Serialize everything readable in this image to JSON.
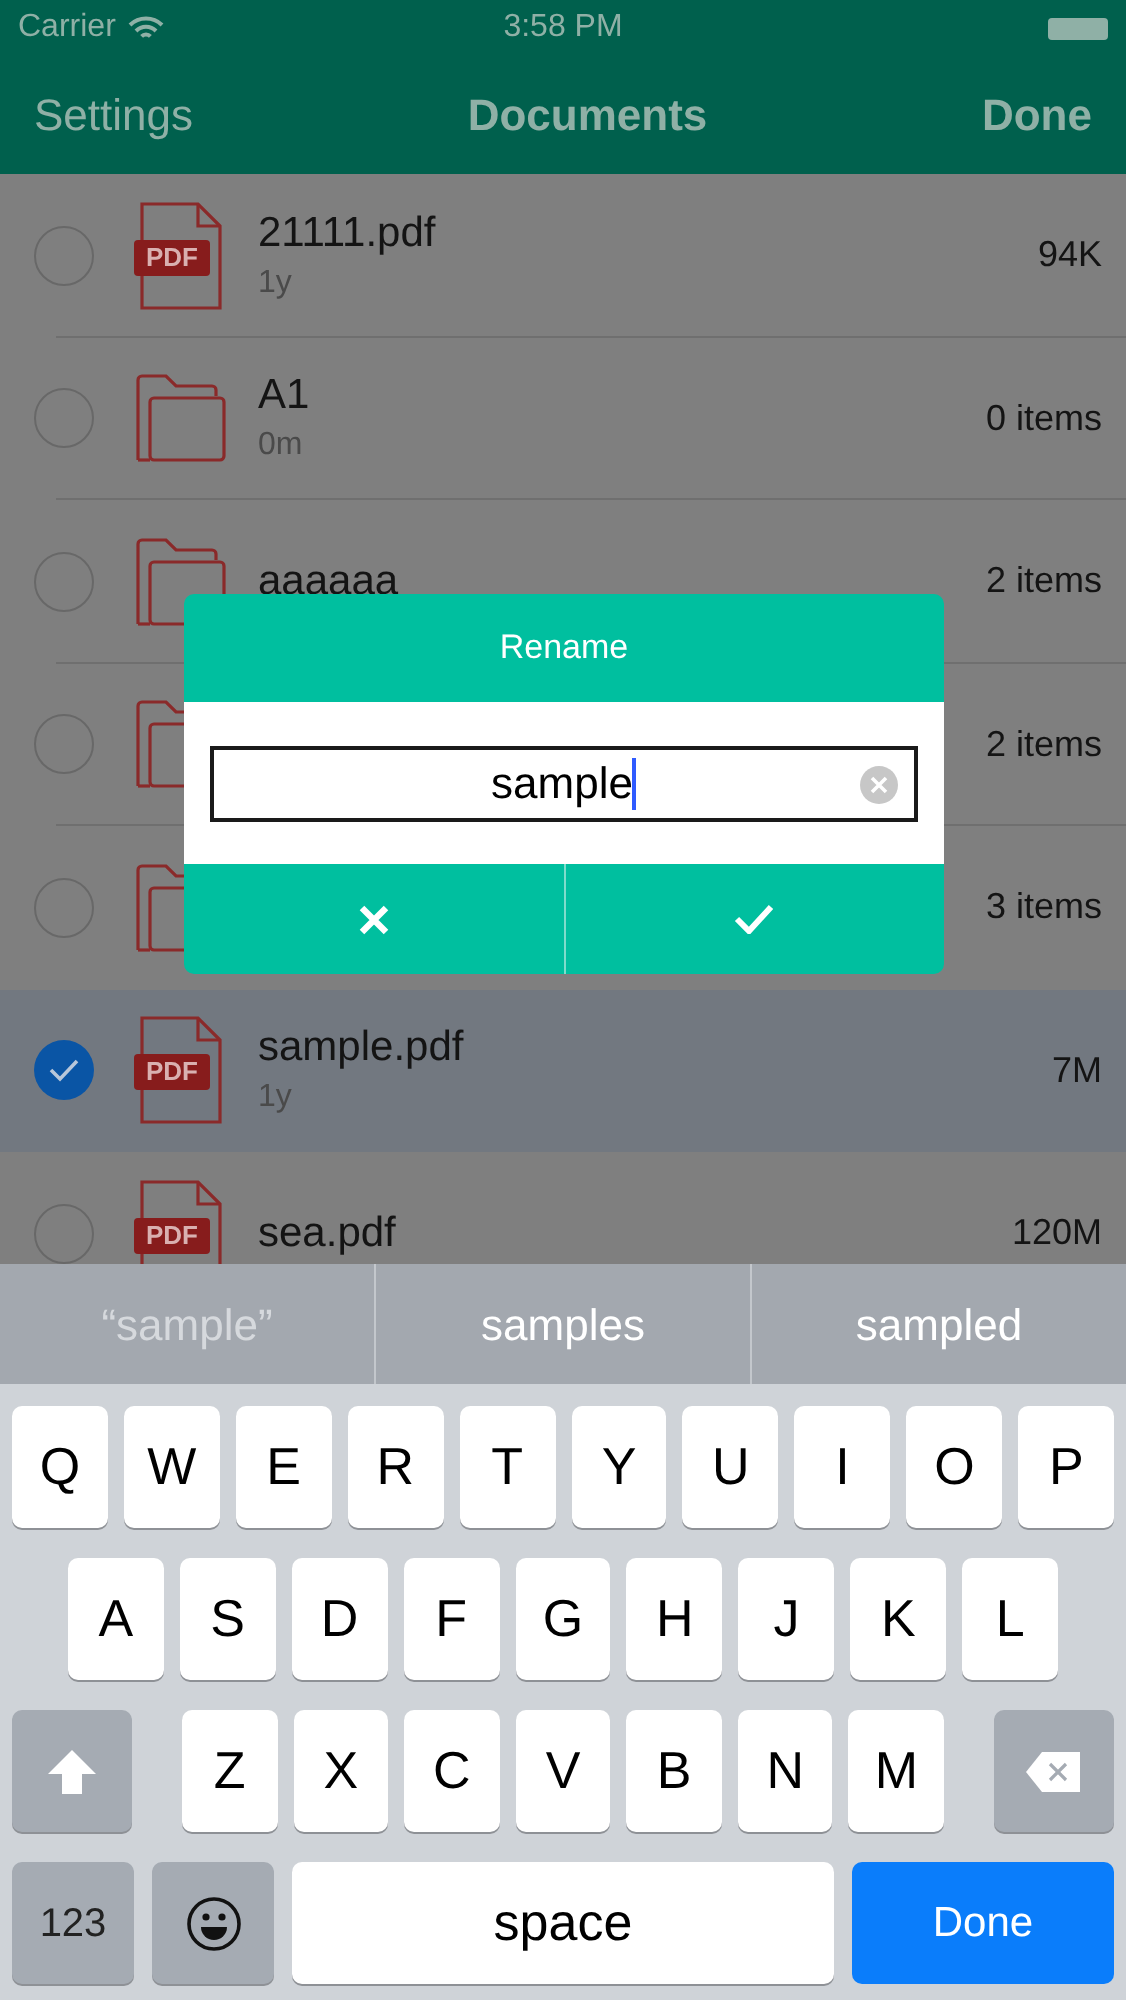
{
  "status_bar": {
    "carrier": "Carrier",
    "time": "3:58 PM"
  },
  "nav": {
    "left": "Settings",
    "title": "Documents",
    "right": "Done"
  },
  "files": [
    {
      "kind": "pdf",
      "badge": "PDF",
      "name": "21111.pdf",
      "age": "1y",
      "size": "94K",
      "selected": false
    },
    {
      "kind": "folder",
      "name": "A1",
      "age": "0m",
      "size": "0 items",
      "selected": false
    },
    {
      "kind": "folder",
      "name": "aaaaaa",
      "size": "2 items",
      "selected": false
    },
    {
      "kind": "folder",
      "size": "2 items",
      "selected": false
    },
    {
      "kind": "folder",
      "size": "3 items",
      "selected": false
    },
    {
      "kind": "pdf",
      "badge": "PDF",
      "name": "sample.pdf",
      "age": "1y",
      "size": "7M",
      "selected": true
    },
    {
      "kind": "pdf",
      "badge": "PDF",
      "name": "sea.pdf",
      "size": "120M",
      "selected": false
    }
  ],
  "dialog": {
    "title": "Rename",
    "value": "sample"
  },
  "suggestions": [
    {
      "kind": "typed",
      "text": "“sample”"
    },
    {
      "kind": "word",
      "text": "samples"
    },
    {
      "kind": "word",
      "text": "sampled"
    }
  ],
  "keyboard": {
    "rows": [
      [
        "Q",
        "W",
        "E",
        "R",
        "T",
        "Y",
        "U",
        "I",
        "O",
        "P"
      ],
      [
        "A",
        "S",
        "D",
        "F",
        "G",
        "H",
        "J",
        "K",
        "L"
      ],
      [
        "Z",
        "X",
        "C",
        "V",
        "B",
        "N",
        "M"
      ]
    ],
    "numbers": "123",
    "space": "space",
    "return": "Done"
  }
}
